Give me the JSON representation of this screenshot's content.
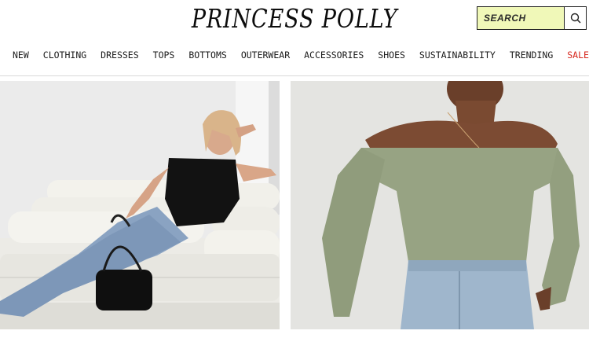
{
  "brand": {
    "logo_text": "PRINCESS POLLY"
  },
  "search": {
    "placeholder": "SEARCH",
    "value": "",
    "icon": "search-icon"
  },
  "nav": {
    "items": [
      {
        "label": "NEW"
      },
      {
        "label": "CLOTHING"
      },
      {
        "label": "DRESSES"
      },
      {
        "label": "TOPS"
      },
      {
        "label": "BOTTOMS"
      },
      {
        "label": "OUTERWEAR"
      },
      {
        "label": "ACCESSORIES"
      },
      {
        "label": "SHOES"
      },
      {
        "label": "SUSTAINABILITY"
      },
      {
        "label": "TRENDING"
      },
      {
        "label": "SALE"
      }
    ]
  },
  "colors": {
    "search_bg": "#f0f8b8",
    "sale": "#d6261c",
    "text": "#1a1a1a"
  }
}
